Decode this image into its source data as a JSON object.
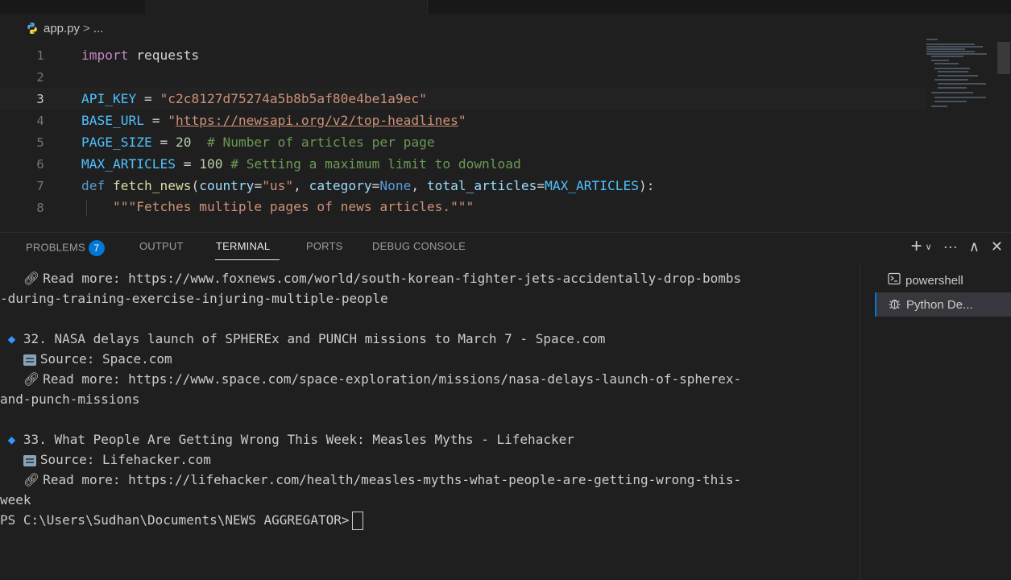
{
  "editor": {
    "breadcrumb": {
      "file": "app.py",
      "separator": ">",
      "rest": "..."
    },
    "lines": [
      {
        "n": "1"
      },
      {
        "n": "2"
      },
      {
        "n": "3"
      },
      {
        "n": "4"
      },
      {
        "n": "5"
      },
      {
        "n": "6"
      },
      {
        "n": "7"
      },
      {
        "n": "8"
      }
    ],
    "code": {
      "l1_kw": "import",
      "l1_mod": " requests",
      "l3_var": "API_KEY",
      "l3_eq": " = ",
      "l3_str": "\"c2c8127d75274a5b8b5af80e4be1a9ec\"",
      "l4_var": "BASE_URL",
      "l4_eq": " = ",
      "l4_q1": "\"",
      "l4_url": "https://newsapi.org/v2/top-headlines",
      "l4_q2": "\"",
      "l5_var": "PAGE_SIZE",
      "l5_eq": " = ",
      "l5_num": "20",
      "l5_cm": "  # Number of articles per page",
      "l6_var": "MAX_ARTICLES",
      "l6_eq": " = ",
      "l6_num": "100",
      "l6_cm": " # Setting a maximum limit to download",
      "l7_def": "def",
      "l7_fn": " fetch_news",
      "l7_p1": "(",
      "l7_a1": "country",
      "l7_e1": "=",
      "l7_s1": "\"us\"",
      "l7_c1": ", ",
      "l7_a2": "category",
      "l7_e2": "=",
      "l7_none": "None",
      "l7_c2": ", ",
      "l7_a3": "total_articles",
      "l7_e3": "=",
      "l7_max": "MAX_ARTICLES",
      "l7_p2": "):",
      "l8_doc": "\"\"\"Fetches multiple pages of news articles.\"\"\""
    }
  },
  "panel": {
    "tabs": {
      "problems": "PROBLEMS",
      "problems_count": "7",
      "output": "OUTPUT",
      "terminal": "TERMINAL",
      "ports": "PORTS",
      "debug": "DEBUG CONSOLE"
    },
    "actions": {
      "add": "+",
      "dropdown": "∨",
      "more": "···",
      "maximize": "∧",
      "close": "✕"
    }
  },
  "terminal": {
    "lines": {
      "t1": "Read more: https://www.foxnews.com/world/south-korean-fighter-jets-accidentally-drop-bombs",
      "t2": "-during-training-exercise-injuring-multiple-people",
      "t3": "32. NASA delays launch of SPHEREx and PUNCH missions to March 7 - Space.com",
      "t4": "Source: Space.com",
      "t5": "Read more: https://www.space.com/space-exploration/missions/nasa-delays-launch-of-spherex-",
      "t6": "and-punch-missions",
      "t7": "33. What People Are Getting Wrong This Week: Measles Myths - Lifehacker",
      "t8": "Source: Lifehacker.com",
      "t9": "Read more: https://lifehacker.com/health/measles-myths-what-people-are-getting-wrong-this-",
      "t10": "week",
      "prompt": "PS C:\\Users\\Sudhan\\Documents\\NEWS AGGREGATOR>"
    },
    "bullet": "◆",
    "link_icon": "🔗︎",
    "instances": [
      {
        "label": "powershell",
        "icon": "terminal-icon"
      },
      {
        "label": "Python De...",
        "icon": "bug-icon"
      }
    ]
  }
}
